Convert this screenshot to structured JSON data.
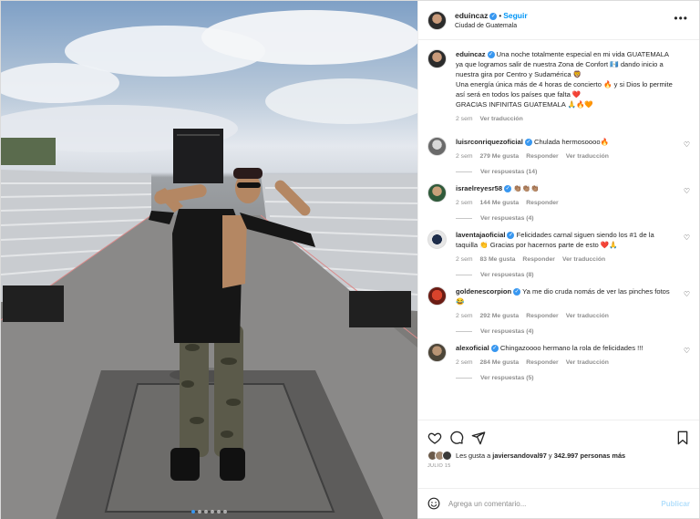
{
  "post": {
    "username": "eduincaz",
    "follow_label": "Seguir",
    "location": "Ciudad de Guatemala",
    "more_icon": "more-horizontal-icon",
    "image_count": 6,
    "active_image": 1
  },
  "caption": {
    "username": "eduincaz",
    "text_1": "Una noche totalmente especial en mi vida GUATEMALA ya que logramos salir de nuestra Zona de Confort 🇬🇹 dando inicio a nuestra gira por Centro y Sudamérica 🦁",
    "text_2": "Una energía única más de 4 horas de concierto 🔥 y si Dios lo permite así será en todos los países que falta ❤️",
    "text_3": "GRACIAS INFINITAS GUATEMALA 🙏🔥🧡",
    "time": "2 sem",
    "translate": "Ver traducción"
  },
  "comments": [
    {
      "username": "luisrconriquezoficial",
      "verified": true,
      "text": "Chulada hermosoooo🔥",
      "time": "2 sem",
      "likes": "279 Me gusta",
      "reply": "Responder",
      "translate": "Ver traducción",
      "replies": "Ver respuestas (14)"
    },
    {
      "username": "israelreyesr58",
      "verified": true,
      "text": "👏🏽👏🏽👏🏽",
      "time": "2 sem",
      "likes": "144 Me gusta",
      "reply": "Responder",
      "translate": "",
      "replies": "Ver respuestas (4)"
    },
    {
      "username": "laventajaoficial",
      "verified": true,
      "text": "Felicidades carnal siguen siendo los #1 de la taquilla 👏 Gracias por hacernos parte de esto ❤️🙏",
      "time": "2 sem",
      "likes": "83 Me gusta",
      "reply": "Responder",
      "translate": "Ver traducción",
      "replies": "Ver respuestas (8)"
    },
    {
      "username": "goldenescorpion",
      "verified": true,
      "text": "Ya me dio cruda nomás de ver las pinches fotos 😂",
      "time": "2 sem",
      "likes": "292 Me gusta",
      "reply": "Responder",
      "translate": "Ver traducción",
      "replies": "Ver respuestas (4)"
    },
    {
      "username": "alexoficial",
      "verified": true,
      "text": "Chingazoooo hermano la rola de felicidades !!!",
      "time": "2 sem",
      "likes": "284 Me gusta",
      "reply": "Responder",
      "translate": "Ver traducción",
      "replies": "Ver respuestas (5)"
    }
  ],
  "actions": {
    "like_icon": "heart-outline-icon",
    "comment_icon": "comment-bubble-icon",
    "share_icon": "paper-plane-icon",
    "save_icon": "bookmark-icon",
    "likes_prefix": "Les gusta a",
    "likes_user": "javiersandoval97",
    "likes_join": "y",
    "likes_count": "342.997 personas más",
    "date": "JULIO 15"
  },
  "add_comment": {
    "placeholder": "Agrega un comentario...",
    "publish_label": "Publicar",
    "emoji_icon": "smiley-icon"
  }
}
